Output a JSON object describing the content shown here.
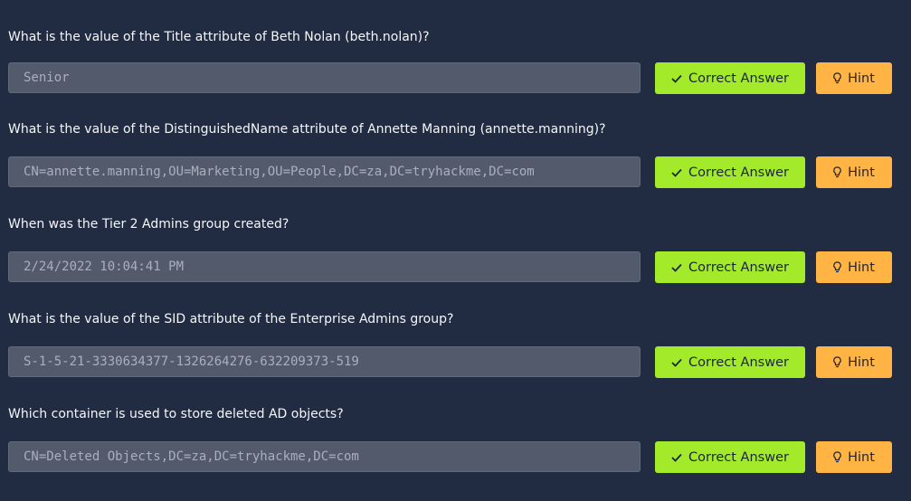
{
  "buttons": {
    "correct_label": "Correct Answer",
    "hint_label": "Hint"
  },
  "questions": [
    {
      "question": "What is the value of the Title attribute of Beth Nolan (beth.nolan)?",
      "answer": "Senior"
    },
    {
      "question": "What is the value of the DistinguishedName attribute of Annette Manning (annette.manning)?",
      "answer": "CN=annette.manning,OU=Marketing,OU=People,DC=za,DC=tryhackme,DC=com"
    },
    {
      "question": "When was the Tier 2 Admins group created?",
      "answer": "2/24/2022 10:04:41 PM"
    },
    {
      "question": "What is the value of the SID attribute of the Enterprise Admins group?",
      "answer": "S-1-5-21-3330634377-1326264276-632209373-519"
    },
    {
      "question": "Which container is used to store deleted AD objects?",
      "answer": "CN=Deleted Objects,DC=za,DC=tryhackme,DC=com"
    }
  ],
  "colors": {
    "background": "#212c42",
    "correct_button": "#a3ea2a",
    "hint_button": "#ffb443",
    "answer_field": "#535a6b"
  },
  "icons": {
    "correct": "check-icon",
    "hint": "lightbulb-icon"
  }
}
